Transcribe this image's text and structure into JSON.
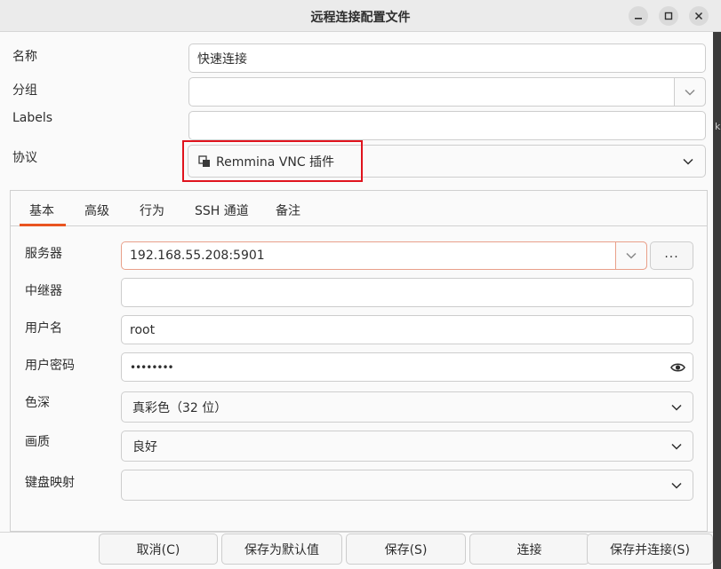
{
  "window": {
    "title": "远程连接配置文件",
    "controls": [
      "minimize-icon",
      "maximize-icon",
      "close-icon"
    ],
    "edge_text": "k"
  },
  "form": {
    "name_label": "名称",
    "name_value": "快速连接",
    "group_label": "分组",
    "group_value": "",
    "labels_label": "Labels",
    "labels_value": "",
    "protocol_label": "协议",
    "protocol_value": "Remmina VNC 插件"
  },
  "tabs": [
    {
      "label": "基本",
      "active": true
    },
    {
      "label": "高级"
    },
    {
      "label": "行为"
    },
    {
      "label": "SSH 通道"
    },
    {
      "label": "备注"
    }
  ],
  "basic": {
    "server_label": "服务器",
    "server_value": "192.168.55.208:5901",
    "server_more": "...",
    "repeater_label": "中继器",
    "repeater_value": "",
    "username_label": "用户名",
    "username_value": "root",
    "password_label": "用户密码",
    "password_value": "••••••••",
    "color_depth_label": "色深",
    "color_depth_value": "真彩色（32 位）",
    "quality_label": "画质",
    "quality_value": "良好",
    "keymap_label": "键盘映射",
    "keymap_value": ""
  },
  "buttons": {
    "cancel": "取消(C)",
    "save_default": "保存为默认值",
    "save": "保存(S)",
    "connect": "连接",
    "save_connect": "保存并连接(S)"
  },
  "colors": {
    "accent": "#e95420",
    "highlight_box": "#e0131d",
    "focus_border": "#e9a08a"
  }
}
